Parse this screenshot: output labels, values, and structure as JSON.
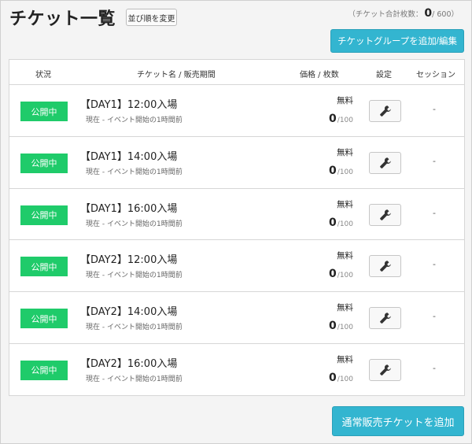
{
  "page": {
    "title": "チケット一覧",
    "sort_label": "並び順を変更",
    "total_label": "（チケット合計枚数：",
    "total_count": "0",
    "total_max": "/ 600）",
    "add_group_label": "チケットグループを追加/編集",
    "add_ticket_label": "通常販売チケットを追加"
  },
  "table": {
    "headers": {
      "status": "状況",
      "name": "チケット名 / 販売期間",
      "price": "価格 / 枚数",
      "settings": "設定",
      "session": "セッション"
    },
    "rows": [
      {
        "status": "公開中",
        "name": "【DAY1】12:00入場",
        "period": "現在 - イベント開始の1時間前",
        "price": "無料",
        "sold": "0",
        "stock_max": "/100",
        "session": "-"
      },
      {
        "status": "公開中",
        "name": "【DAY1】14:00入場",
        "period": "現在 - イベント開始の1時間前",
        "price": "無料",
        "sold": "0",
        "stock_max": "/100",
        "session": "-"
      },
      {
        "status": "公開中",
        "name": "【DAY1】16:00入場",
        "period": "現在 - イベント開始の1時間前",
        "price": "無料",
        "sold": "0",
        "stock_max": "/100",
        "session": "-"
      },
      {
        "status": "公開中",
        "name": "【DAY2】12:00入場",
        "period": "現在 - イベント開始の1時間前",
        "price": "無料",
        "sold": "0",
        "stock_max": "/100",
        "session": "-"
      },
      {
        "status": "公開中",
        "name": "【DAY2】14:00入場",
        "period": "現在 - イベント開始の1時間前",
        "price": "無料",
        "sold": "0",
        "stock_max": "/100",
        "session": "-"
      },
      {
        "status": "公開中",
        "name": "【DAY2】16:00入場",
        "period": "現在 - イベント開始の1時間前",
        "price": "無料",
        "sold": "0",
        "stock_max": "/100",
        "session": "-"
      }
    ]
  },
  "colors": {
    "status_public": "#1fcb6a",
    "accent": "#33b5d0"
  },
  "icons": {
    "settings": "wrench-icon"
  }
}
